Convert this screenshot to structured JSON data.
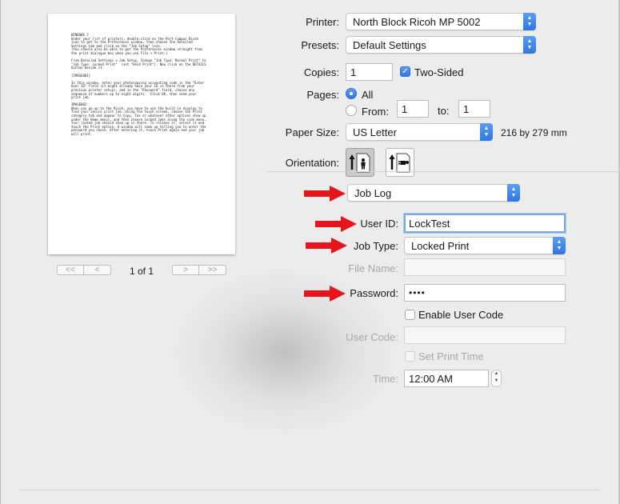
{
  "preview": {
    "text_lines": [
      "WINDOWS 7",
      "Under your list of printers, double-click on the Port Campus Ricoh",
      "icon to get to the Preferences window, then choose the Detailed",
      "Settings tab and click on the \"Job Setup\" icon.",
      "(You should also be able to get the Preferences window straight from",
      "the print dialogue box when you use File > Print.)",
      "",
      "From Detailed Settings > Job Setup, Change \"Job Type: Normal Print\" to",
      "\"Job Type: Locked Print\"  (not \"Hold Print\"). Now click on the DETAILS",
      "button beside it.",
      "",
      "[IMAGE001]",
      "",
      "In this window, enter your photocopying accounting code in the \"Enter",
      "User ID\" field (it might already have your ID in there from your",
      "previous printer setup), and in the \"Password\" field, choose any",
      "sequence of numbers up to eight digits.  Click OK, then send your",
      "print job.",
      "",
      "IMAGE002",
      "When you go up to the Ricoh, you have to use the built-in display to",
      "find your secure print job. Using the touch screen, choose the Print",
      "category tab and appear to Copy, Fax or whatever other options show up",
      "under the Home menu), and then choose Locked Jobs along the side menu.",
      "Your locked job should show up in there. To release it, select it and",
      "touch the Print option. A window will come up telling you to enter the",
      "password you chose. After entering it, touch Print again and your job",
      "will print."
    ],
    "page_count": "1 of 1",
    "nav_first": "<<",
    "nav_prev": "<",
    "nav_next": ">",
    "nav_last": ">>"
  },
  "form": {
    "printer_label": "Printer:",
    "printer_value": "North Block Ricoh MP 5002",
    "presets_label": "Presets:",
    "presets_value": "Default Settings",
    "copies_label": "Copies:",
    "copies_value": "1",
    "two_sided_label": "Two-Sided",
    "two_sided_checked": true,
    "pages_label": "Pages:",
    "pages_all_label": "All",
    "pages_from_label": "From:",
    "pages_from_value": "1",
    "pages_to_label": "to:",
    "pages_to_value": "1",
    "paper_size_label": "Paper Size:",
    "paper_size_value": "US Letter",
    "paper_size_dims": "216 by 279 mm",
    "orientation_label": "Orientation:",
    "section_value": "Job Log",
    "user_id_label": "User ID:",
    "user_id_value": "LockTest",
    "job_type_label": "Job Type:",
    "job_type_value": "Locked Print",
    "file_name_label": "File Name:",
    "file_name_value": "",
    "password_label": "Password:",
    "password_value": "••••",
    "enable_user_code_label": "Enable User Code",
    "user_code_label": "User Code:",
    "user_code_value": "",
    "set_print_time_label": "Set Print Time",
    "time_label": "Time:",
    "time_value": "12:00 AM"
  },
  "colors": {
    "accent": "#2f76e0",
    "annotation_arrow": "#e8141c"
  },
  "icons": {
    "popup_arrows": "up-down-chevron-icon",
    "portrait": "portrait-orientation-icon",
    "landscape": "landscape-orientation-icon",
    "annotation": "red-arrow-icon"
  }
}
